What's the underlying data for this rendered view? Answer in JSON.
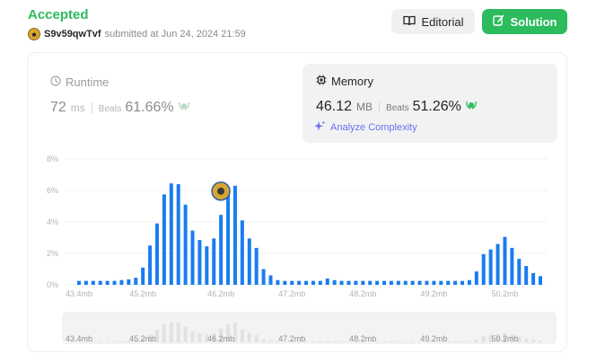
{
  "submission": {
    "status": "Accepted",
    "username": "S9v59qwTvf",
    "submitted_text": "submitted at Jun 24, 2024 21:59"
  },
  "toolbar": {
    "editorial_label": "Editorial",
    "solution_label": "Solution"
  },
  "runtime": {
    "title": "Runtime",
    "value": "72",
    "unit": "ms",
    "beats_label": "Beats",
    "beats_pct": "61.66%"
  },
  "memory": {
    "title": "Memory",
    "value": "46.12",
    "unit": "MB",
    "beats_label": "Beats",
    "beats_pct": "51.26%",
    "analyze_label": "Analyze Complexity"
  },
  "colors": {
    "accent_green": "#2cbb5d",
    "bar_blue": "#1a7cf0",
    "analyze_purple": "#6e6ef5"
  },
  "icons": {
    "runtime": "clock-icon",
    "memory": "chip-icon",
    "editorial": "book-icon",
    "solution": "edit-icon",
    "analyze": "sparkle-icon",
    "beats": "laurel-icon"
  },
  "chart_data": {
    "type": "bar",
    "y_ticks": [
      "0%",
      "2%",
      "4%",
      "6%",
      "8%"
    ],
    "ylim": [
      0,
      8
    ],
    "x_ticks": [
      "43.4mb",
      "45.2mb",
      "46.2mb",
      "47.2mb",
      "48.2mb",
      "49.2mb",
      "50.2mb"
    ],
    "grid": true,
    "series": [
      {
        "values": [
          0.25,
          0.25,
          0.25,
          0.25,
          0.25,
          0.25,
          0.3,
          0.35,
          0.45,
          1.1,
          2.5,
          3.9,
          5.75,
          6.45,
          6.4,
          5.1,
          3.45,
          2.85,
          2.45,
          2.95,
          4.45,
          5.9,
          6.3,
          4.1,
          2.95,
          2.35,
          1.0,
          0.6,
          0.3,
          0.25,
          0.25,
          0.25,
          0.25,
          0.25,
          0.25,
          0.4,
          0.3,
          0.25,
          0.25,
          0.25,
          0.25,
          0.25,
          0.25,
          0.25,
          0.25,
          0.25,
          0.25,
          0.25,
          0.25,
          0.25,
          0.25,
          0.25,
          0.25,
          0.25,
          0.25,
          0.3,
          0.85,
          1.95,
          2.25,
          2.6,
          3.05,
          2.35,
          1.65,
          1.2,
          0.75,
          0.55
        ]
      }
    ],
    "highlight_index": 21
  }
}
